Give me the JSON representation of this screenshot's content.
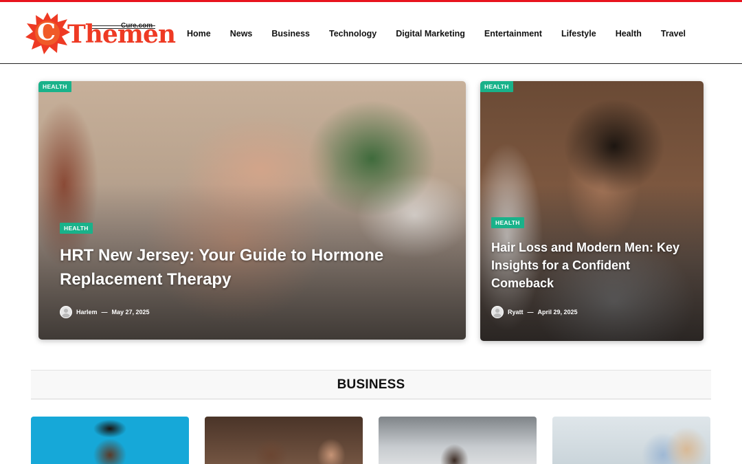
{
  "site": {
    "logo_letter": "C",
    "logo_word": "Themen",
    "logo_domain": "Cure.com",
    "brand_color": "#ee3a24",
    "top_bar_color": "#e8141e"
  },
  "nav": {
    "items": [
      "Home",
      "News",
      "Business",
      "Technology",
      "Digital Marketing",
      "Entertainment",
      "Lifestyle",
      "Health",
      "Travel"
    ]
  },
  "featured": {
    "main": {
      "top_badge": "HEALTH",
      "category": "HEALTH",
      "title": "HRT New Jersey: Your Guide to Hormone Replacement Therapy",
      "author": "Harlem",
      "separator": "—",
      "date": "May 27, 2025"
    },
    "side": {
      "top_badge": "HEALTH",
      "category": "HEALTH",
      "title": "Hair Loss and Modern Men: Key Insights for a Confident Comeback",
      "author": "Ryatt",
      "separator": "—",
      "date": "April 29, 2025"
    },
    "badge_color": "#19b28a"
  },
  "section": {
    "title": "BUSINESS"
  }
}
